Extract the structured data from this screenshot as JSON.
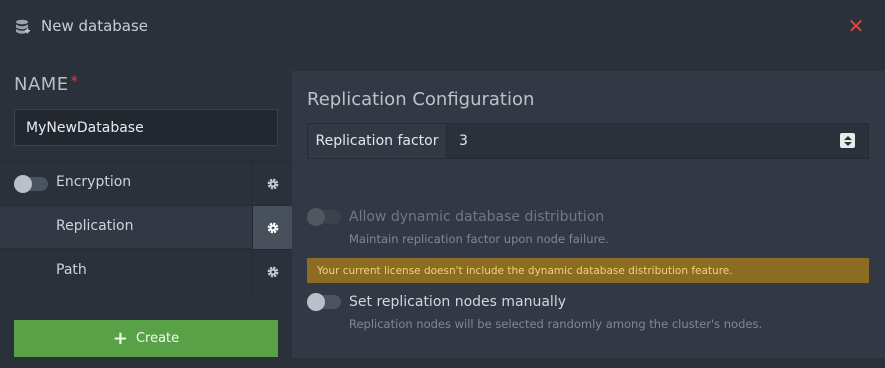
{
  "header": {
    "title": "New database",
    "db_icon": "database-add-icon",
    "close_icon": "close-icon"
  },
  "form": {
    "name_label": "NAME",
    "required_mark": "*",
    "name_value": "MyNewDatabase"
  },
  "options": [
    {
      "label": "Encryption",
      "toggle": "off"
    },
    {
      "label": "Replication",
      "active": true
    },
    {
      "label": "Path"
    }
  ],
  "create_label": "Create",
  "replication": {
    "title": "Replication Configuration",
    "factor_label": "Replication factor",
    "factor_value": "3",
    "dynamic_title": "Allow dynamic database distribution",
    "dynamic_desc": "Maintain replication factor upon node failure.",
    "warning": "Your current license doesn't include the dynamic database distribution feature.",
    "manual_title": "Set replication nodes manually",
    "manual_desc": "Replication nodes will be selected randomly among the cluster's nodes."
  },
  "colors": {
    "accent_green": "#58a146",
    "close_red": "#e0403c",
    "warning_bg": "#8c6b23",
    "warning_text": "#f3d27a"
  }
}
